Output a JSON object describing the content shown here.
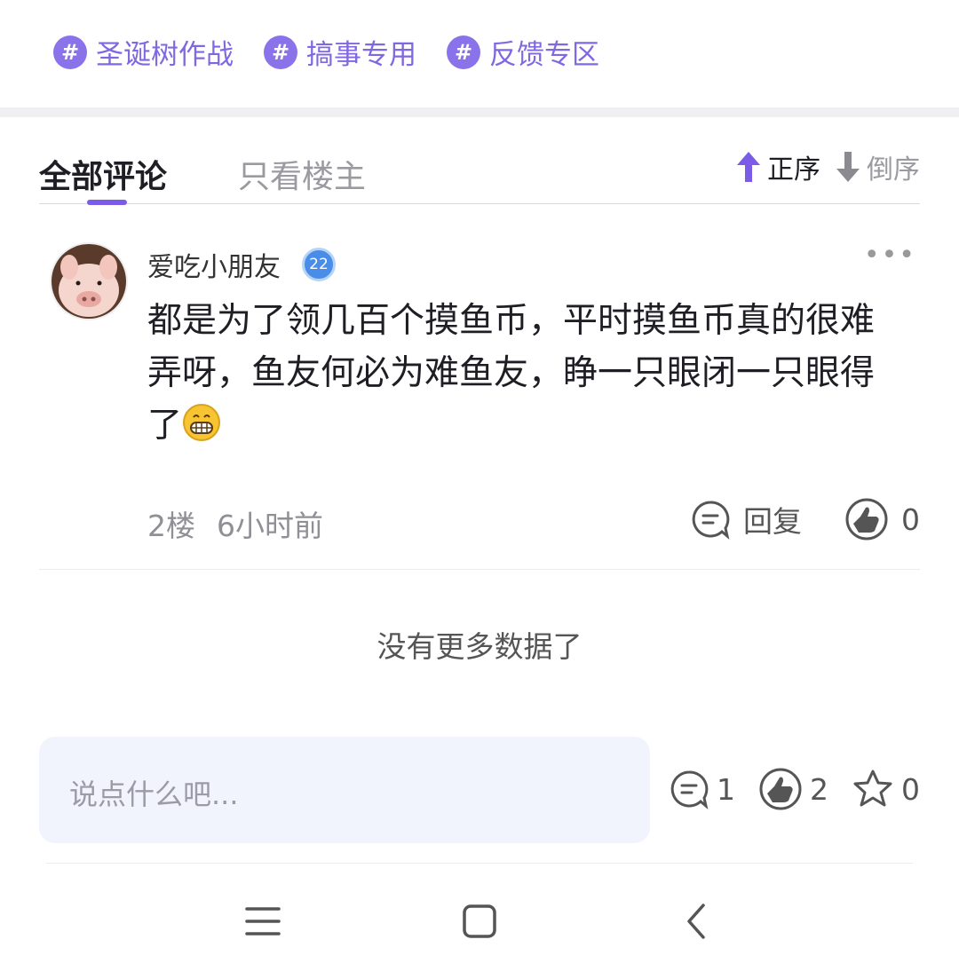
{
  "tags": [
    {
      "label": "圣诞树作战",
      "icon": "hash-icon"
    },
    {
      "label": "搞事专用",
      "icon": "hash-icon"
    },
    {
      "label": "反馈专区",
      "icon": "hash-icon"
    }
  ],
  "tabs": {
    "all": "全部评论",
    "owner_only": "只看楼主"
  },
  "sort": {
    "asc": "正序",
    "desc": "倒序"
  },
  "comment": {
    "username": "爱吃小朋友",
    "level": "22",
    "text": "都是为了领几百个摸鱼币，平时摸鱼币真的很难弄呀，鱼友何必为难鱼友，睁一只眼闭一只眼得了",
    "floor": "2楼",
    "time": "6小时前",
    "reply_label": "回复",
    "like_count": "0"
  },
  "no_more": "没有更多数据了",
  "input": {
    "placeholder": "说点什么吧..."
  },
  "stats": {
    "comments": "1",
    "likes": "2",
    "favorites": "0"
  },
  "colors": {
    "accent": "#7a5ce6",
    "tag_text": "#8068e0",
    "input_bg": "#f1f3fd"
  }
}
